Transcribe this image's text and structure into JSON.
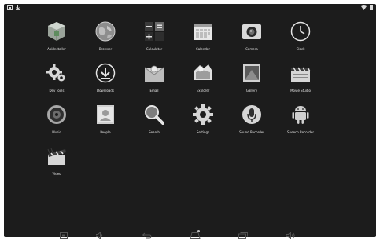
{
  "statusbar": {
    "left_icons": [
      "screenshot-icon",
      "download-icon"
    ],
    "right_icons": [
      "wifi-icon",
      "battery-icon"
    ]
  },
  "apps": [
    {
      "label": "ApkInstaller",
      "icon": "package-icon"
    },
    {
      "label": "Browser",
      "icon": "globe-icon"
    },
    {
      "label": "Calculator",
      "icon": "calculator-icon"
    },
    {
      "label": "Calendar",
      "icon": "calendar-icon"
    },
    {
      "label": "Camera",
      "icon": "camera-icon"
    },
    {
      "label": "Clock",
      "icon": "clock-icon"
    },
    {
      "label": "Dev Tools",
      "icon": "gear-icon"
    },
    {
      "label": "Downloads",
      "icon": "download-icon"
    },
    {
      "label": "Email",
      "icon": "email-icon"
    },
    {
      "label": "Explorer",
      "icon": "folder-icon"
    },
    {
      "label": "Gallery",
      "icon": "picture-icon"
    },
    {
      "label": "Movie Studio",
      "icon": "clapperboard-icon"
    },
    {
      "label": "Music",
      "icon": "speaker-icon"
    },
    {
      "label": "People",
      "icon": "contact-icon"
    },
    {
      "label": "Search",
      "icon": "magnifier-icon"
    },
    {
      "label": "Settings",
      "icon": "settings-gear-icon"
    },
    {
      "label": "Sound Recorder",
      "icon": "microphone-icon"
    },
    {
      "label": "Speech Recorder",
      "icon": "android-icon"
    },
    {
      "label": "Video",
      "icon": "video-clapper-icon"
    }
  ],
  "navbar": [
    "screenshot-icon",
    "volume-down-icon",
    "back-icon",
    "home-icon",
    "recents-icon",
    "volume-up-icon"
  ]
}
